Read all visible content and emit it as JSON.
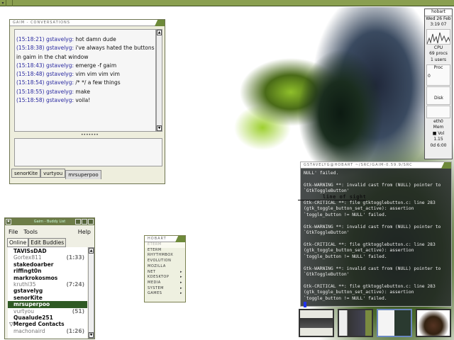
{
  "chat": {
    "title": "GAIM - CONVERSATIONS",
    "messages": [
      {
        "time": "(15:18:21)",
        "nick": "gstavelyg:",
        "text": "hot damn dude"
      },
      {
        "time": "(15:18:38)",
        "nick": "gstavelyg:",
        "text": "i've always hated the buttons"
      },
      {
        "time": "",
        "nick": "",
        "text": "in gaim in the chat window"
      },
      {
        "time": "(15:18:43)",
        "nick": "gstavelyg:",
        "text": "emerge -f gaim"
      },
      {
        "time": "(15:18:48)",
        "nick": "gstavelyg:",
        "text": "vim vim vim vim"
      },
      {
        "time": "(15:18:54)",
        "nick": "gstavelyg:",
        "text": "/* */ a few things"
      },
      {
        "time": "(15:18:55)",
        "nick": "gstavelyg:",
        "text": "make"
      },
      {
        "time": "(15:18:58)",
        "nick": "gstavelyg:",
        "text": "voila!"
      }
    ],
    "tabs": [
      "senorKite",
      "vurtyou",
      "mrsuperpoo"
    ]
  },
  "buddy": {
    "title": "Gaim - Buddy List",
    "menu": [
      "File",
      "Tools",
      "Help"
    ],
    "tabs": [
      "Online",
      "Edit Buddies"
    ],
    "buddies": [
      {
        "name": "TAVISsDAD",
        "idle": ""
      },
      {
        "name": "Gortex811",
        "idle": "(1:33)"
      },
      {
        "name": "stakedoarber",
        "idle": ""
      },
      {
        "name": "riffingt0n",
        "idle": ""
      },
      {
        "name": "markrokosmos",
        "idle": ""
      },
      {
        "name": "kruthl35",
        "idle": "(7:24)"
      },
      {
        "name": "gstavelyg",
        "idle": ""
      },
      {
        "name": "senorKite",
        "idle": ""
      },
      {
        "name": "mrsuperpoo",
        "idle": ""
      },
      {
        "name": "vurtyou",
        "idle": "(51)"
      },
      {
        "name": "Quaalude251",
        "idle": ""
      },
      {
        "name": "Merged Contacts",
        "idle": ""
      },
      {
        "name": "machonaird",
        "idle": "(1:26)"
      }
    ]
  },
  "appmenu": {
    "title": "HOBART",
    "items": [
      "ETERM",
      "ETERM",
      "RHYTHMBOX",
      "EVOLUTION",
      "MOZILLA",
      "NET",
      "KDESKTOP",
      "MEDIA",
      "SYSTEM",
      "GAMES"
    ]
  },
  "terminal": {
    "title": "GSTAVELYG@HOBART ~/SRC/GAIM-0.59.9/SRC",
    "text": "NULL' failed.\n\nGtk-WARNING **: invalid cast from (NULL) pointer to `GtkToggleButton'\n\nGtk-CRITICAL **: file gtktogglebutton.c: line 283 (gtk_toggle_button_set_active): assertion `toggle_button != NULL' failed.\n\nGtk-WARNING **: invalid cast from (NULL) pointer to `GtkToggleButton'\n\nGtk-CRITICAL **: file gtktogglebutton.c: line 283 (gtk_toggle_button_set_active): assertion `toggle_button != NULL' failed.\n\nGtk-WARNING **: invalid cast from (NULL) pointer to `GtkToggleButton'\n\nGtk-CRITICAL **: file gtktogglebutton.c: line 283 (gtk_toggle_button_set_active): assertion `toggle_button != NULL' failed.\n"
  },
  "monitor": {
    "host": "hobart",
    "date": "Wed 26 Feb",
    "time": "3:19 07",
    "cpu": "CPU",
    "procs": "69 procs",
    "users": "1 users",
    "proc": "Proc",
    "proc_val": "0",
    "disk": "Disk",
    "net": "eth0",
    "mem": "Mem",
    "vol": "Vol",
    "load": "1.15",
    "uptime": "0d 6:00"
  },
  "desktop_art_text": "line of sight"
}
